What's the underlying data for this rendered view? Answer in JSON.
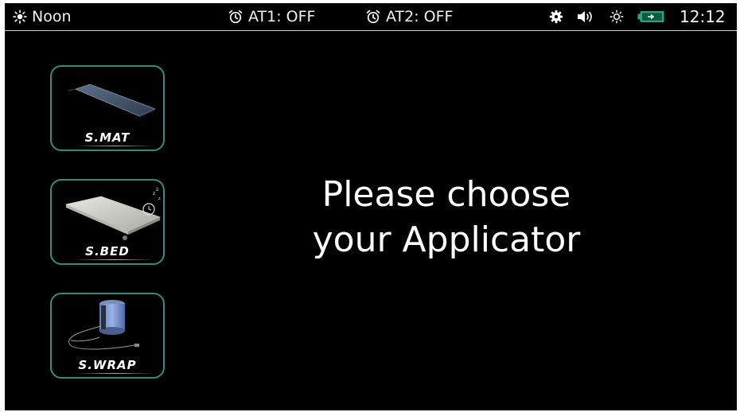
{
  "status_bar": {
    "mode_label": "Noon",
    "mode_icon": "sun-icon",
    "alarm1_label": "AT1: OFF",
    "alarm2_label": "AT2: OFF",
    "alarm_icon": "alarm-clock-icon",
    "settings_icon": "gear-icon",
    "volume_icon": "speaker-icon",
    "brightness_icon": "brightness-icon",
    "battery_icon": "battery-charging-icon",
    "clock": "12:12"
  },
  "applicators": [
    {
      "label": "S.MAT",
      "icon": "mat-applicator-image"
    },
    {
      "label": "S.BED",
      "icon": "bed-applicator-image"
    },
    {
      "label": "S.WRAP",
      "icon": "wrap-applicator-image"
    }
  ],
  "prompt": {
    "line1": "Please choose",
    "line2": "your Applicator"
  },
  "colors": {
    "background": "#000000",
    "button_border": "#3a8a78",
    "battery": "#2fa37a"
  }
}
